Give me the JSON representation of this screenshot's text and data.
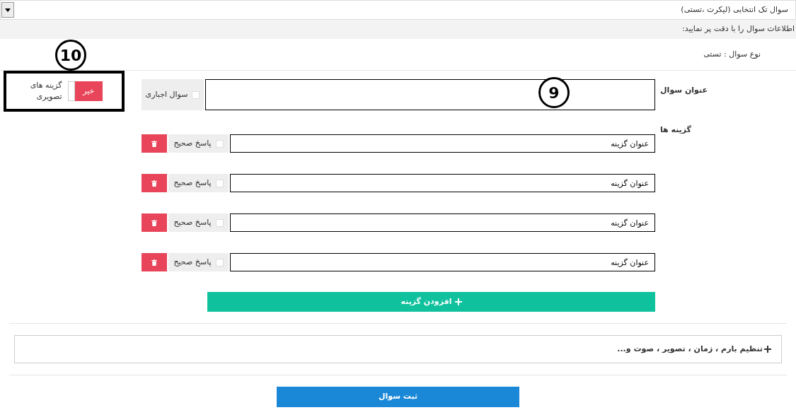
{
  "question_type_select": {
    "value": "سوال تک انتخابی (لیکرت ،تستی)"
  },
  "instructions": "اطلاعات سوال را با دقت پر نمایید:",
  "question_type": "نوع سوال : تستی",
  "image_options": {
    "label": "گزینه های تصویری",
    "on": false,
    "text": "خیر"
  },
  "title_label": "عنوان سوال",
  "mandatory": {
    "label": "سوال اجباری",
    "checked": false
  },
  "options_label": "گزینه ها",
  "options": [
    {
      "value": "عنوان گزینه",
      "correct_label": "پاسخ صحیح",
      "correct": false
    },
    {
      "value": "عنوان گزینه",
      "correct_label": "پاسخ صحیح",
      "correct": false
    },
    {
      "value": "عنوان گزینه",
      "correct_label": "پاسخ صحیح",
      "correct": false
    },
    {
      "value": "عنوان گزینه",
      "correct_label": "پاسخ صحیح",
      "correct": false
    }
  ],
  "add_option": "افزودن گزینه",
  "advanced": "تنظیم بارم ، زمان ، تصویر ، صوت و...",
  "submit": "ثبت سوال",
  "callouts": [
    {
      "label": "9"
    },
    {
      "label": "10"
    }
  ]
}
